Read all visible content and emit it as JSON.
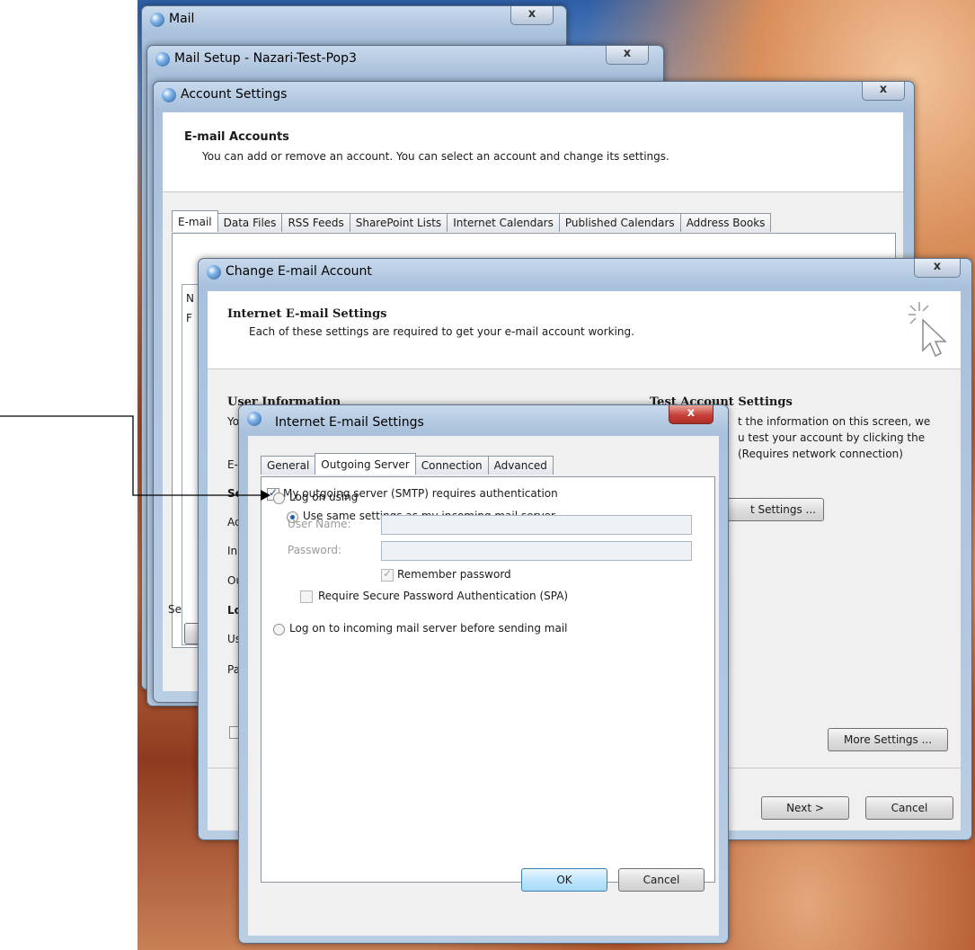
{
  "windows": {
    "mail": {
      "title": "Mail",
      "close": "x"
    },
    "mail_setup": {
      "title": "Mail Setup - Nazari-Test-Pop3",
      "close": "x"
    },
    "account_settings": {
      "title": "Account Settings",
      "close": "x",
      "header_title": "E-mail Accounts",
      "header_subtitle": "You can add or remove an account. You can select an account and change its settings.",
      "tabs": [
        "E-mail",
        "Data Files",
        "RSS Feeds",
        "SharePoint Lists",
        "Internet Calendars",
        "Published Calendars",
        "Address Books"
      ],
      "clipped": {
        "n": "N",
        "f": "F",
        "se": "Se"
      }
    },
    "change_account": {
      "title": "Change E-mail Account",
      "close": "x",
      "header_title": "Internet E-mail Settings",
      "header_subtitle": "Each of these settings are required to get your e-mail account working.",
      "user_info_heading": "User Information",
      "test_heading": "Test Account Settings",
      "test_text_1": "t the information on this screen, we",
      "test_text_2": "u test your account by clicking the",
      "test_text_3": "(Requires network connection)",
      "test_button": "t Settings ...",
      "more_settings": "More Settings ...",
      "next": "Next >",
      "cancel": "Cancel",
      "clipped": {
        "yo": "Yo",
        "e": "E-",
        "se": "Se",
        "ac": "Ac",
        "in": "In",
        "ou": "Ou",
        "lo": "Lo",
        "us": "Us",
        "pa": "Pa"
      }
    },
    "internet_settings": {
      "title": "Internet E-mail Settings",
      "close": "x",
      "tabs": [
        "General",
        "Outgoing Server",
        "Connection",
        "Advanced"
      ],
      "requires_auth": "My outgoing server (SMTP) requires authentication",
      "use_same": "Use same settings as my incoming mail server",
      "log_on_using": "Log on using",
      "user_name_label": "User Name:",
      "password_label": "Password:",
      "remember_password": "Remember password",
      "require_spa": "Require Secure Password Authentication (SPA)",
      "log_on_incoming": "Log on to incoming mail server before sending mail",
      "ok": "OK",
      "cancel": "Cancel"
    }
  },
  "colors": {
    "accent": "#1f5fb3",
    "close_red": "#c5403a"
  }
}
